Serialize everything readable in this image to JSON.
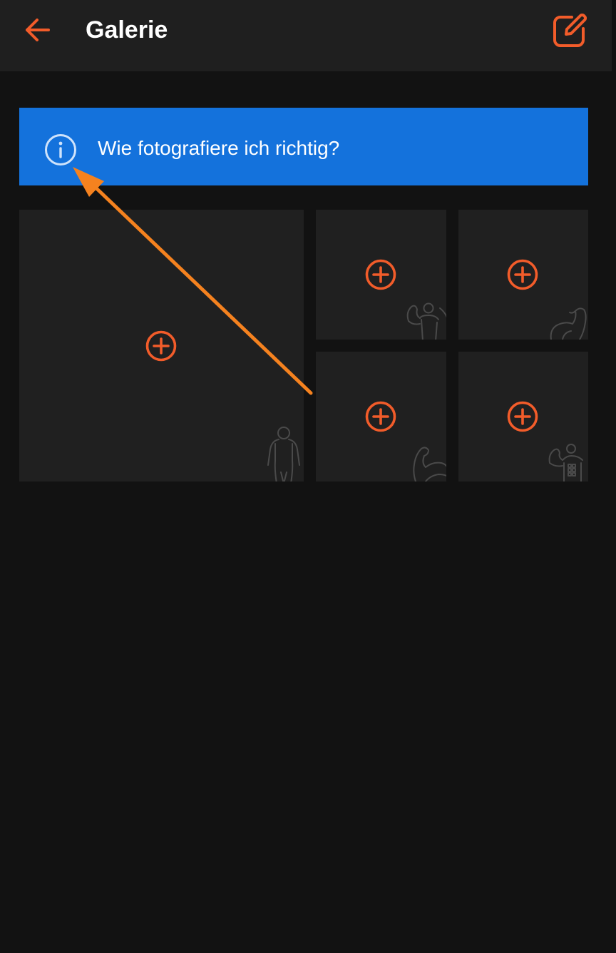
{
  "header": {
    "title": "Galerie",
    "back_icon": "arrow-left-icon",
    "edit_icon": "edit-icon"
  },
  "info_banner": {
    "icon": "info-icon",
    "text": "Wie fotografiere ich richtig?"
  },
  "gallery": {
    "tiles": [
      {
        "pose": "front-full-body",
        "icon": "plus-circle-icon"
      },
      {
        "pose": "front-double-biceps",
        "icon": "plus-circle-icon"
      },
      {
        "pose": "side-biceps",
        "icon": "plus-circle-icon"
      },
      {
        "pose": "flexed-arm",
        "icon": "plus-circle-icon"
      },
      {
        "pose": "abs-and-thigh",
        "icon": "plus-circle-icon"
      }
    ]
  },
  "colors": {
    "accent": "#f25c2a",
    "banner": "#1472dc",
    "background": "#121212",
    "header": "#1f1f1f",
    "tile": "#202020",
    "annotation_arrow": "#f5821f"
  }
}
